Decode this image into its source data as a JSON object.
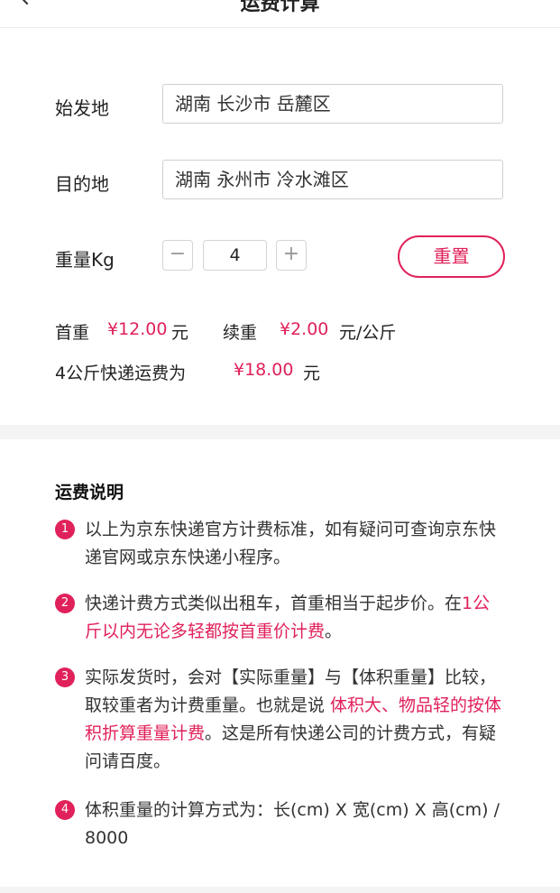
{
  "header": {
    "title": "运费计算"
  },
  "form": {
    "origin_label": "始发地",
    "origin_value": "湖南 长沙市 岳麓区",
    "destination_label": "目的地",
    "destination_value": "湖南 永州市 冷水滩区",
    "weight_label": "重量Kg",
    "minus": "−",
    "quantity": "4",
    "plus": "+",
    "reset_label": "重置"
  },
  "price": {
    "first_label": "首重",
    "first_value": "¥12.00",
    "first_unit": "元",
    "cont_label": "续重",
    "cont_value": "¥2.00",
    "cont_unit": "元/公斤",
    "total_label": "4公斤快递运费为",
    "total_value": "¥18.00",
    "total_unit": "元"
  },
  "notes": {
    "title": "运费说明",
    "items": [
      {
        "num": "1",
        "a": "以上为京东快递官方计费标准，如有疑问可查询京东快递官网或京东快递小程序。",
        "b": "",
        "c": ""
      },
      {
        "num": "2",
        "a": "快递计费方式类似出租车，首重相当于起步价。在",
        "b": "1公斤以内无论多轻都按首重价计费",
        "c": "。"
      },
      {
        "num": "3",
        "a": "实际发货时，会对【实际重量】与【体积重量】比较，取较重者为计费重量。也就是说 ",
        "b": "体积大、物品轻的按体积折算重量计费",
        "c": "。这是所有快递公司的计费方式，有疑问请百度。"
      },
      {
        "num": "4",
        "a": "体积重量的计算方式为：长(cm) X 宽(cm) X 高(cm) / 8000",
        "b": "",
        "c": ""
      }
    ]
  },
  "colors": {
    "accent": "#e0215a",
    "background": "#f4f4f4"
  }
}
